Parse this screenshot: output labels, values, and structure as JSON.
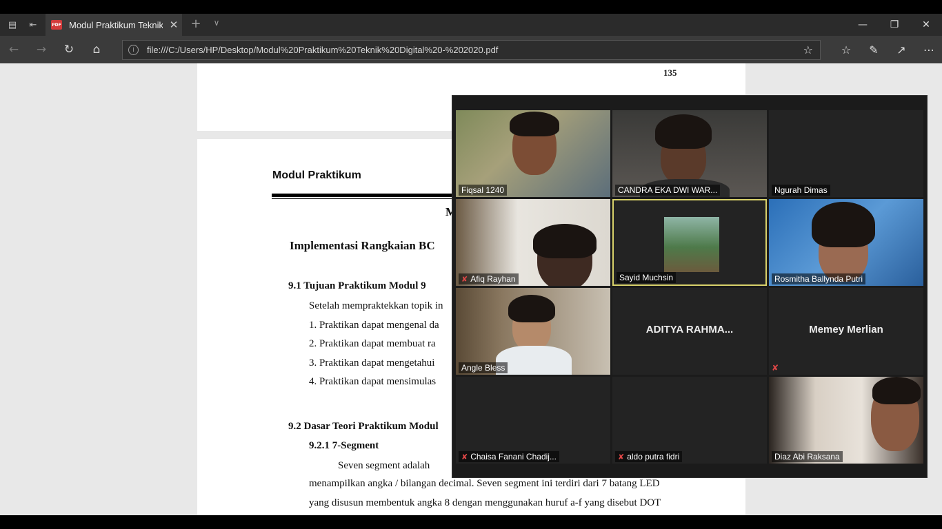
{
  "browser": {
    "tab_title": "Modul Praktikum Teknik",
    "tab_badge": "PDF",
    "url": "file:///C:/Users/HP/Desktop/Modul%20Praktikum%20Teknik%20Digital%20-%202020.pdf"
  },
  "pdf": {
    "page_number": "135",
    "header": "Modul Praktikum",
    "center_initial": "M",
    "chapter_title": "Implementasi Rangkaian BC",
    "s91_title": "9.1  Tujuan Praktikum Modul 9",
    "s91_intro": "Setelah mempraktekkan topik in",
    "s91_items": [
      "1.   Praktikan dapat mengenal da",
      "2.   Praktikan dapat membuat ra",
      "3.   Praktikan  dapat mengetahui",
      "4.   Praktikan dapat mensimulas"
    ],
    "s92_title": "9.2  Dasar Teori Praktikum Modul",
    "s921_title": "9.2.1  7-Segment",
    "para_line1": "Seven    segment    adalah",
    "para_line2": "menampilkan angka / bilangan decimal. Seven segment ini terdiri dari 7 batang LED",
    "para_line3": "yang disusun membentuk angka 8 dengan menggunakan huruf a-f yang disebut DOT"
  },
  "meeting": {
    "participants": [
      {
        "name": "Fiqsal 1240",
        "muted": false
      },
      {
        "name": "CANDRA EKA DWI WAR...",
        "muted": false
      },
      {
        "name": "Ngurah Dimas",
        "muted": false
      },
      {
        "name": "Afiq Rayhan",
        "muted": true
      },
      {
        "name": "Sayid Muchsin",
        "muted": false
      },
      {
        "name": "Rosmitha Ballynda Putri",
        "muted": false
      },
      {
        "name": "Angle Bless",
        "muted": false
      },
      {
        "name": "ADITYA  RAHMA...",
        "muted": false
      },
      {
        "name": "Memey Merlian",
        "muted": true
      },
      {
        "name": "Chaisa Fanani Chadij...",
        "muted": true
      },
      {
        "name": "aldo putra fidri",
        "muted": true
      },
      {
        "name": "Diaz Abi Raksana",
        "muted": false
      }
    ],
    "active_speaker_color": "#d9d26b",
    "muted_icon_color": "#e24848"
  }
}
